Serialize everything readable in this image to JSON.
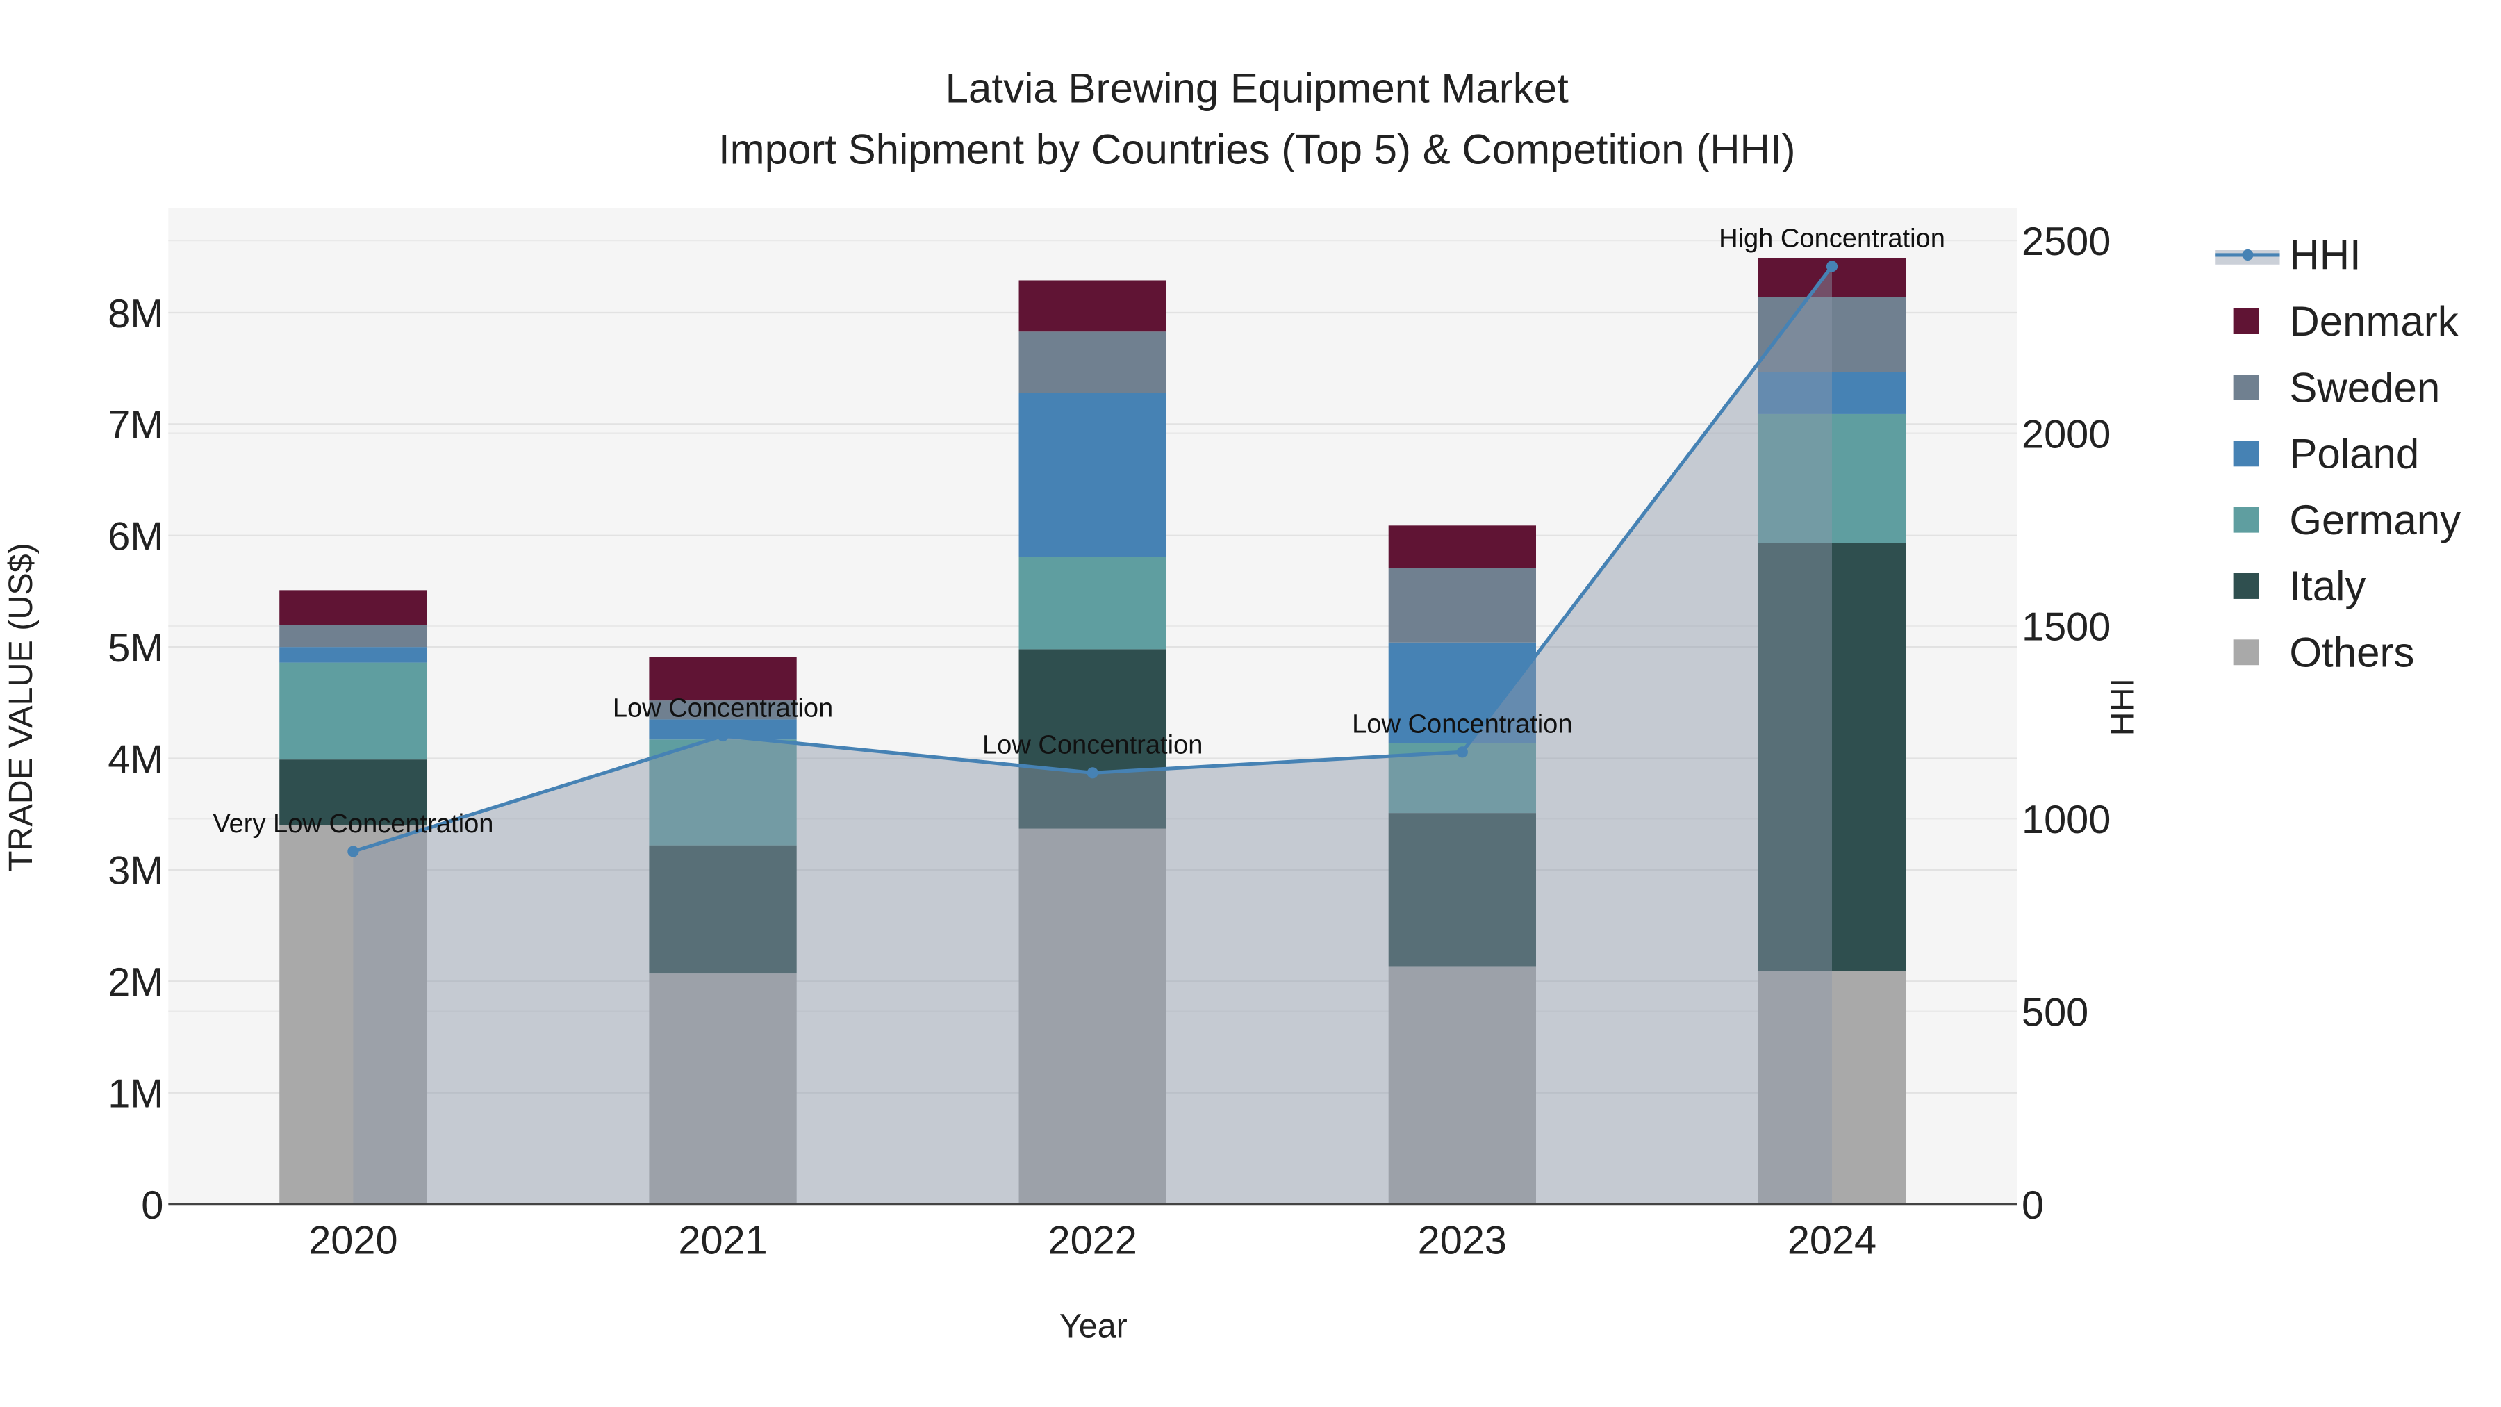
{
  "chart_data": {
    "type": "bar",
    "title_line1": "Latvia Brewing Equipment Market",
    "title_line2": "Import Shipment by Countries (Top 5) & Competition (HHI)",
    "xlabel": "Year",
    "ylabel": "TRADE VALUE (US$)",
    "y2label": "HHI",
    "categories": [
      "2020",
      "2021",
      "2022",
      "2023",
      "2024"
    ],
    "ylim": [
      0,
      8900000
    ],
    "yticks": [
      0,
      1000000,
      2000000,
      3000000,
      4000000,
      5000000,
      6000000,
      7000000,
      8000000
    ],
    "ytick_labels": [
      "0",
      "1M",
      "2M",
      "3M",
      "4M",
      "5M",
      "6M",
      "7M",
      "8M"
    ],
    "y2lim": [
      0,
      2580
    ],
    "y2ticks": [
      0,
      500,
      1000,
      1500,
      2000,
      2500
    ],
    "y2tick_labels": [
      "0",
      "500",
      "1000",
      "1500",
      "2000",
      "2500"
    ],
    "grid": true,
    "legend_position": "right",
    "series": [
      {
        "name": "Others",
        "color": "#a9a9a9",
        "values": [
          3400000,
          2070000,
          3370000,
          2130000,
          2090000
        ]
      },
      {
        "name": "Italy",
        "color": "#2f4f4f",
        "values": [
          590000,
          1150000,
          1610000,
          1380000,
          3840000
        ]
      },
      {
        "name": "Germany",
        "color": "#5f9ea0",
        "values": [
          870000,
          950000,
          830000,
          630000,
          1160000
        ]
      },
      {
        "name": "Poland",
        "color": "#4682b4",
        "values": [
          140000,
          180000,
          1470000,
          900000,
          380000
        ]
      },
      {
        "name": "Sweden",
        "color": "#708090",
        "values": [
          200000,
          170000,
          550000,
          670000,
          670000
        ]
      },
      {
        "name": "Denmark",
        "color": "#601434",
        "values": [
          310000,
          390000,
          460000,
          380000,
          350000
        ]
      }
    ],
    "line": {
      "name": "HHI",
      "color": "#4682b4",
      "fill": "rgba(140,150,168,0.45)",
      "values": [
        915,
        1215,
        1119,
        1173,
        2433
      ],
      "annotations": [
        "Very Low Concentration",
        "Low Concentration",
        "Low Concentration",
        "Low Concentration",
        "High Concentration"
      ]
    },
    "legend": [
      "HHI",
      "Denmark",
      "Sweden",
      "Poland",
      "Germany",
      "Italy",
      "Others"
    ]
  }
}
